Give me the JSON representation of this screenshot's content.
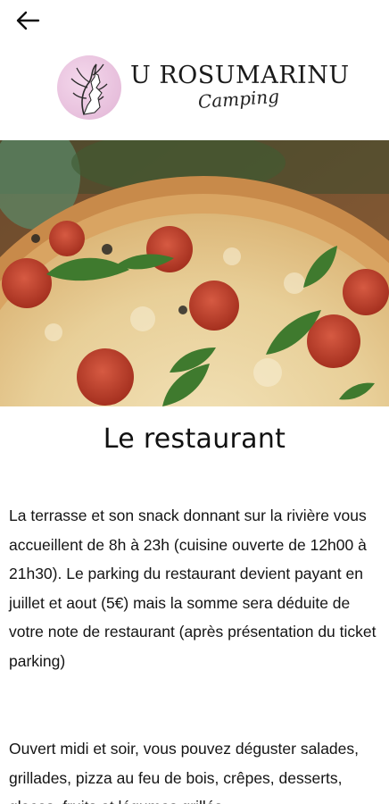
{
  "header": {
    "back_icon": "arrow-left-icon",
    "brand_name": "U ROSUMARINU",
    "brand_sub": "Camping"
  },
  "hero": {
    "image_subject": "pizza"
  },
  "page": {
    "title": "Le restaurant",
    "paragraph_1": "La terrasse et son snack donnant sur la rivière vous accueillent de 8h à 23h (cuisine ouverte de 12h00 à 21h30). Le parking du restaurant devient payant en juillet et aout (5€) mais la somme sera déduite de votre note de restaurant (après présentation du ticket parking)",
    "paragraph_2": "Ouvert midi et soir, vous pouvez déguster salades, grillades, pizza au feu de bois, crêpes, desserts, glaces, fruits et légumes grillés..."
  },
  "colors": {
    "logo_circle": "#e7bfdc",
    "text": "#141414",
    "background": "#ffffff"
  }
}
